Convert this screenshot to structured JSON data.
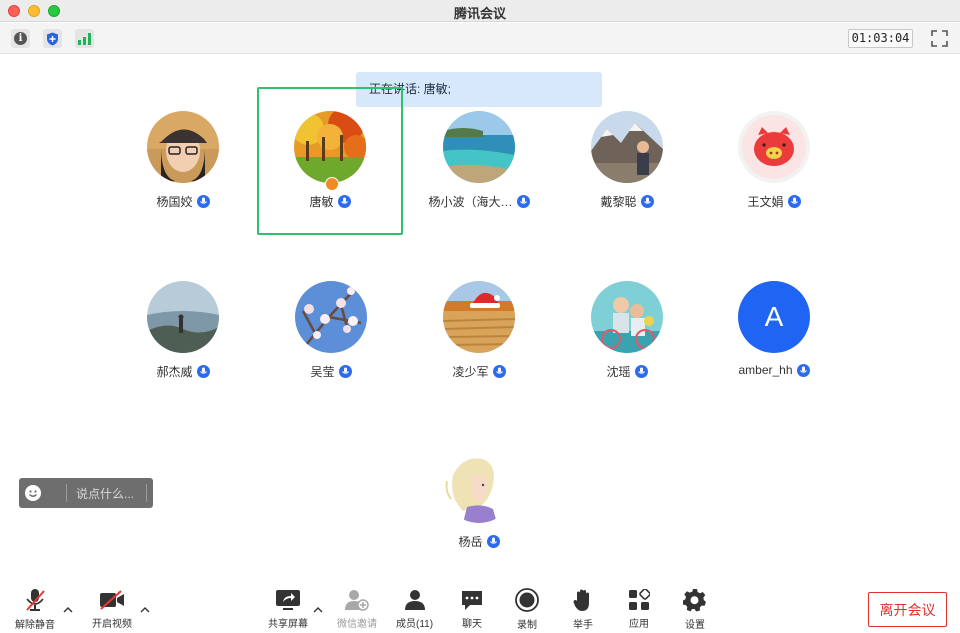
{
  "window": {
    "title": "腾讯会议"
  },
  "status": {
    "timer": "01:03:04"
  },
  "speaking": {
    "text": "正在讲话: 唐敏;"
  },
  "participants": [
    {
      "name": "杨国姣",
      "avatar": "photo-girl-glasses"
    },
    {
      "name": "唐敏",
      "avatar": "photo-autumn-trees",
      "host": true
    },
    {
      "name": "杨小波（海大…",
      "avatar": "photo-sea-coast"
    },
    {
      "name": "戴黎聪",
      "avatar": "photo-mountain-hiker"
    },
    {
      "name": "王文娟",
      "avatar": "photo-red-pig"
    },
    {
      "name": "郝杰威",
      "avatar": "photo-mountain-peak"
    },
    {
      "name": "吴莹",
      "avatar": "photo-plum-blossom"
    },
    {
      "name": "凌少军",
      "avatar": "photo-field-santa-hat"
    },
    {
      "name": "沈瑶",
      "avatar": "photo-couple-bicycle"
    },
    {
      "name": "amber_hh",
      "avatar": "letter",
      "letter": "A"
    },
    {
      "name": "杨岳",
      "avatar": "illustration-girl"
    }
  ],
  "chat": {
    "placeholder": "说点什么..."
  },
  "toolbar": {
    "unmute": "解除静音",
    "start_video": "开启视频",
    "share_screen": "共享屏幕",
    "wechat_invite": "微信邀请",
    "members": "成员(11)",
    "chat": "聊天",
    "record": "录制",
    "raise_hand": "举手",
    "apps": "应用",
    "settings": "设置",
    "leave": "离开会议"
  },
  "colors": {
    "active_speaker": "#2fc16c",
    "mic": "#2c6bf0",
    "leave": "#e0302f",
    "letter_avatar": "#1f64f3"
  }
}
